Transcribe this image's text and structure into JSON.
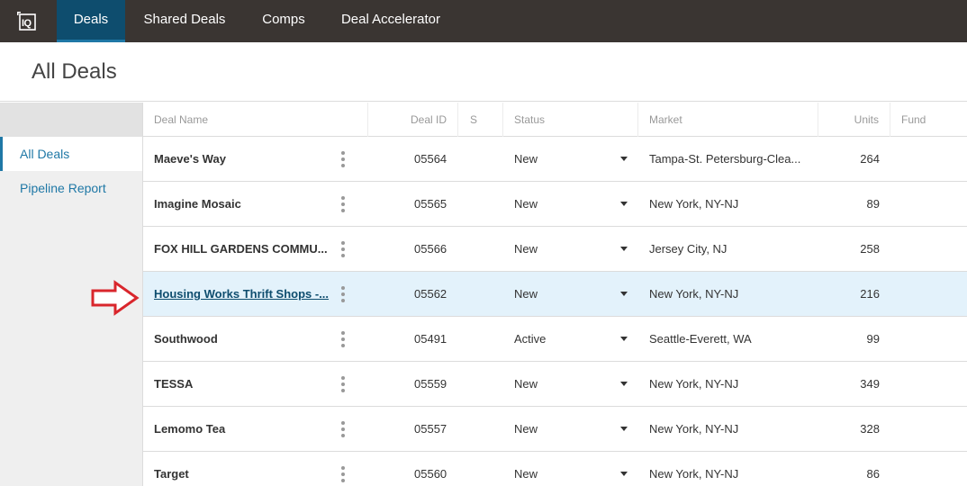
{
  "app": {
    "logo_text": "IQ"
  },
  "nav": {
    "tabs": [
      {
        "label": "Deals",
        "active": true
      },
      {
        "label": "Shared Deals",
        "active": false
      },
      {
        "label": "Comps",
        "active": false
      },
      {
        "label": "Deal Accelerator",
        "active": false
      }
    ]
  },
  "page": {
    "title": "All Deals"
  },
  "sidebar": {
    "items": [
      {
        "label": "All Deals",
        "active": true
      },
      {
        "label": "Pipeline Report",
        "active": false
      }
    ]
  },
  "table": {
    "columns": {
      "deal_name": "Deal Name",
      "deal_id": "Deal ID",
      "s": "S",
      "status": "Status",
      "market": "Market",
      "units": "Units",
      "fund": "Fund"
    },
    "rows": [
      {
        "name": "Maeve's Way",
        "id": "05564",
        "status": "New",
        "market": "Tampa-St. Petersburg-Clea...",
        "units": "264",
        "selected": false
      },
      {
        "name": "Imagine Mosaic",
        "id": "05565",
        "status": "New",
        "market": "New York, NY-NJ",
        "units": "89",
        "selected": false
      },
      {
        "name": "FOX HILL GARDENS COMMU...",
        "id": "05566",
        "status": "New",
        "market": "Jersey City, NJ",
        "units": "258",
        "selected": false
      },
      {
        "name": "Housing Works Thrift Shops -...",
        "id": "05562",
        "status": "New",
        "market": "New York, NY-NJ",
        "units": "216",
        "selected": true
      },
      {
        "name": "Southwood",
        "id": "05491",
        "status": "Active",
        "market": "Seattle-Everett, WA",
        "units": "99",
        "selected": false
      },
      {
        "name": "TESSA",
        "id": "05559",
        "status": "New",
        "market": "New York, NY-NJ",
        "units": "349",
        "selected": false
      },
      {
        "name": "Lemomo Tea",
        "id": "05557",
        "status": "New",
        "market": "New York, NY-NJ",
        "units": "328",
        "selected": false
      },
      {
        "name": "Target",
        "id": "05560",
        "status": "New",
        "market": "New York, NY-NJ",
        "units": "86",
        "selected": false
      }
    ]
  },
  "colors": {
    "nav_bg": "#3a3532",
    "nav_active": "#0e4d6e",
    "accent": "#1f78a6",
    "selected_row": "#e3f2fb",
    "annotation_arrow": "#d9262c"
  }
}
